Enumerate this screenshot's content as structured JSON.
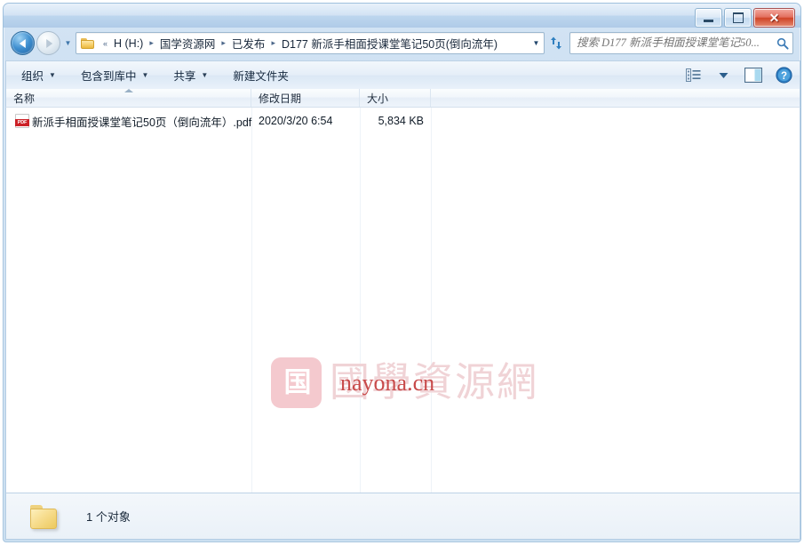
{
  "window": {
    "title": "",
    "controls": {
      "minimize_label": "–",
      "maximize_label": "",
      "close_label": "✕"
    }
  },
  "navigation": {
    "back_tooltip": "后退",
    "forward_tooltip": "前进",
    "history_caret": "▼",
    "address": {
      "leading_chevrons": "«",
      "crumbs": [
        "H (H:)",
        "国学资源网",
        "已发布",
        "D177 新派手相面授课堂笔记50页(倒向流年)"
      ],
      "separator": "▸",
      "dropdown_caret": "▼",
      "refresh_icon": "refresh-icon"
    },
    "search": {
      "placeholder": "搜索 D177 新派手相面授课堂笔记50...",
      "value": "",
      "icon": "search-icon"
    }
  },
  "toolbar": {
    "items": [
      {
        "label": "组织",
        "has_caret": true
      },
      {
        "label": "包含到库中",
        "has_caret": true
      },
      {
        "label": "共享",
        "has_caret": true
      },
      {
        "label": "新建文件夹",
        "has_caret": false
      }
    ],
    "caret": "▼",
    "view_icon": "view-mode-icon",
    "view_caret": "▼",
    "preview_icon": "preview-pane-icon",
    "help_icon": "help-icon",
    "help_glyph": "?"
  },
  "filelist": {
    "columns": [
      {
        "label": "名称",
        "sorted": "asc"
      },
      {
        "label": "修改日期",
        "sorted": ""
      },
      {
        "label": "大小",
        "sorted": ""
      }
    ],
    "rows": [
      {
        "icon": "pdf-file-icon",
        "name": "新派手相面授课堂笔记50页（倒向流年）.pdf",
        "date": "2020/3/20 6:54",
        "size": "5,834 KB"
      }
    ]
  },
  "watermark": {
    "logo_glyph": "国",
    "text": "國學資源網",
    "url": "nayona.cn",
    "logo_color": "#f4c9ce",
    "text_color": "#f0d3d6",
    "url_color": "#c84a4a"
  },
  "statusbar": {
    "icon": "folder-icon",
    "text": "1 个对象"
  },
  "theme": {
    "frame_blue": "#b9d4ec",
    "accent": "#3e8fd0",
    "close_red": "#cf4427",
    "pdf_red": "#cc2127"
  }
}
